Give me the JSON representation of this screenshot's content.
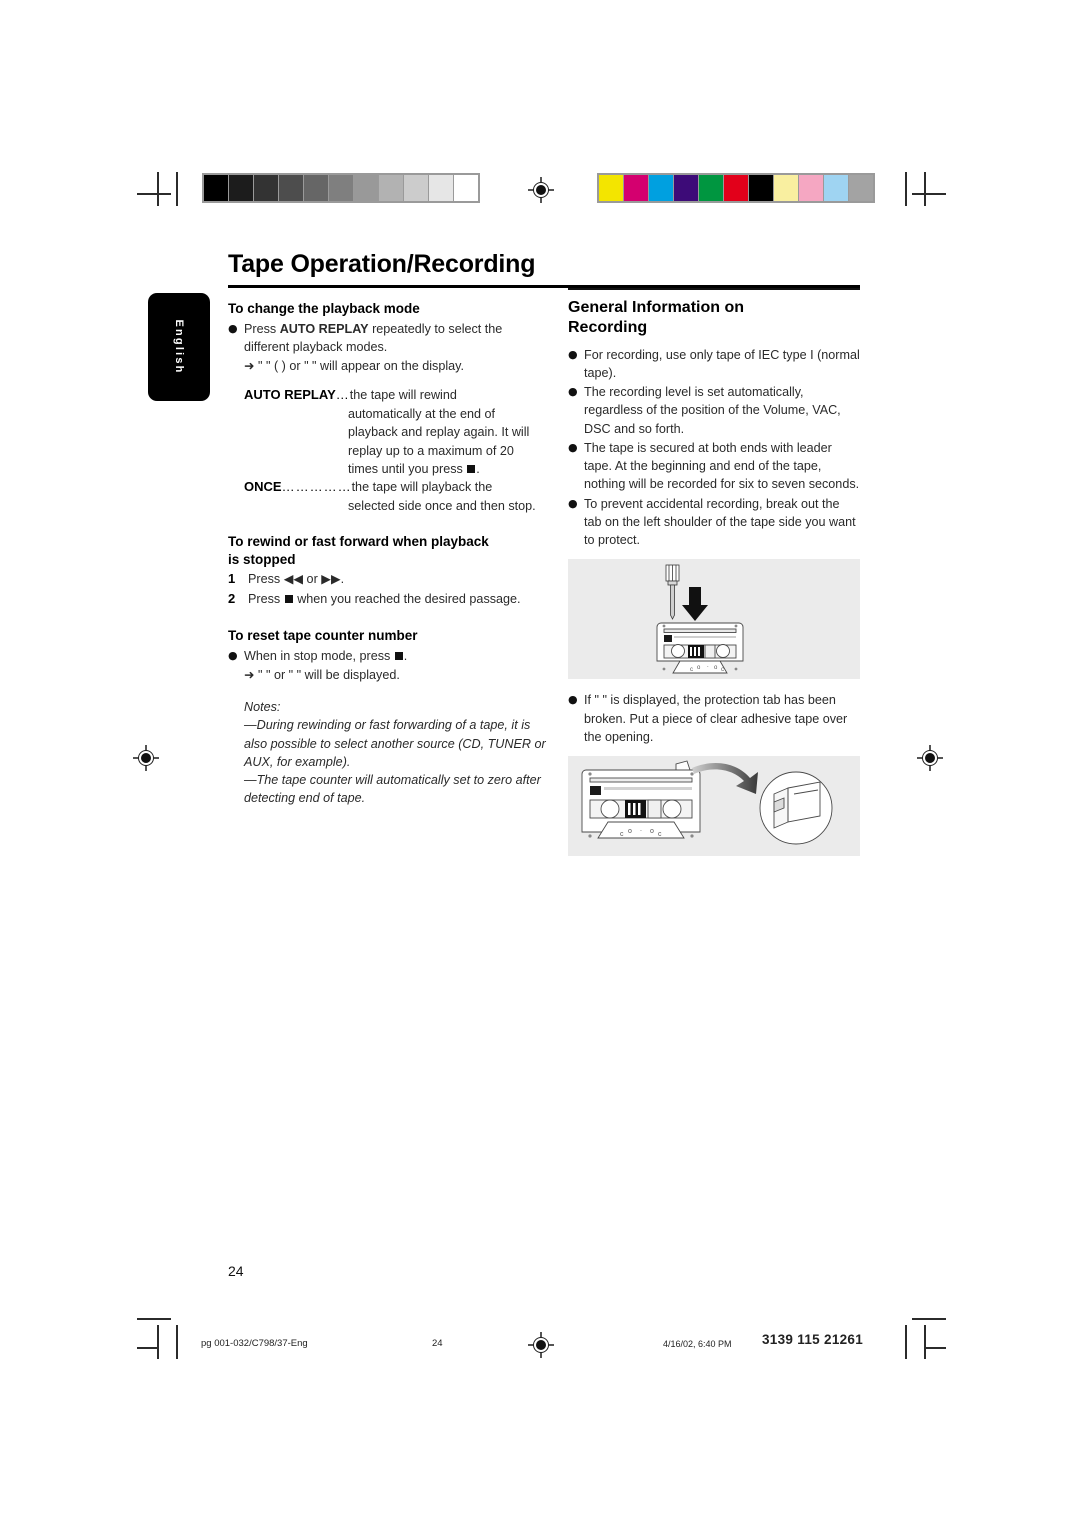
{
  "document": {
    "title": "Tape Operation/Recording",
    "language_tab": "English",
    "page_number": "24"
  },
  "left_column": {
    "section1": {
      "heading": "To change the playback mode",
      "bullet1_pre": "Press ",
      "bullet1_bold": "AUTO REPLAY",
      "bullet1_post": " repeatedly to select the different playback modes.",
      "arrow_line": "➜ \"                    \" (      ) or \"           \" will appear on the display.",
      "def1_term": "AUTO REPLAY",
      "def1_dots": " …",
      "def1_desc": "the tape will rewind",
      "def1_cont1": "automatically at the end of",
      "def1_cont2": "playback and replay again. It will",
      "def1_cont3": "replay up to a maximum of 20",
      "def1_cont4_pre": "times until you press ",
      "def1_cont4_post": ".",
      "def2_term": "ONCE",
      "def2_dots": "……………",
      "def2_desc": "the tape will playback the",
      "def2_cont1": "selected side once and then stop."
    },
    "section2": {
      "heading_line1": "To rewind or fast forward when playback",
      "heading_line2": "is stopped",
      "step1_num": "1",
      "step1_text": "Press ◀◀ or ▶▶.",
      "step2_num": "2",
      "step2_pre": "Press ",
      "step2_post": " when you reached the desired passage."
    },
    "section3": {
      "heading": "To reset tape counter number",
      "bullet_pre": "When in stop mode, press ",
      "bullet_post": ".",
      "arrow_line": "➜ \"            \" or \"              \" will be displayed."
    },
    "notes": {
      "label": "Notes:",
      "note1": "—During rewinding or fast forwarding of a tape, it is also possible to select another source (CD, TUNER or AUX, for example).",
      "note2": "—The tape counter will automatically set to zero after detecting end of tape."
    }
  },
  "right_column": {
    "heading_line1": "General Information on",
    "heading_line2": "Recording",
    "bullets": [
      "For recording, use only tape of IEC type I (normal tape).",
      "The recording level is set automatically, regardless of the position of the Volume, VAC, DSC and so forth.",
      "The tape is secured at both ends with leader tape.  At the beginning and end of the tape, nothing will be recorded for six to seven seconds.",
      "To prevent accidental recording, break out the tab on the left shoulder of the tape side you want to protect."
    ],
    "figure1_caption": "",
    "protection_note": "If \"                     \" is displayed, the protection tab has been broken.  Put a piece of clear adhesive tape over the opening.",
    "figure2_caption": ""
  },
  "footer": {
    "file": "pg 001-032/C798/37-Eng",
    "page": "24",
    "date": "4/16/02, 6:40 PM",
    "code": "3139 115 21261"
  },
  "print_marks": {
    "grayscale_swatches": [
      "#000000",
      "#1c1c1c",
      "#333333",
      "#4d4d4d",
      "#666666",
      "#7f7f7f",
      "#999999",
      "#b2b2b2",
      "#cccccc",
      "#e6e6e6",
      "#ffffff"
    ],
    "color_swatches": [
      "#f3e500",
      "#d4006f",
      "#00a0e0",
      "#3d0b78",
      "#009640",
      "#e2001a",
      "#000000",
      "#f9efa0",
      "#f5a7c2",
      "#9fd4f2",
      "#a3a3a3"
    ]
  }
}
